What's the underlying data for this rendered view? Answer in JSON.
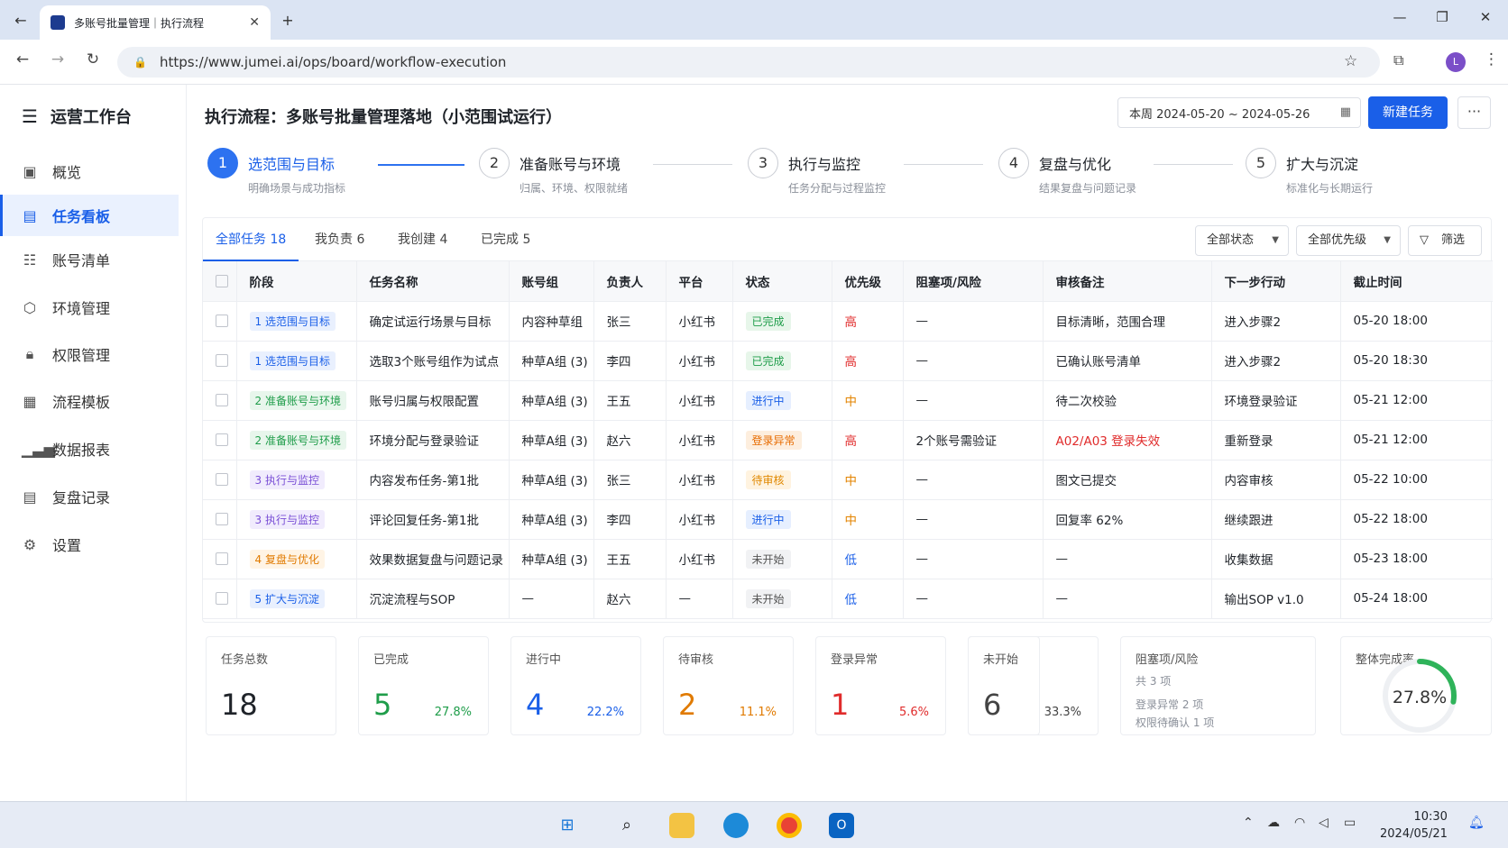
{
  "browser": {
    "tab_title": "多账号批量管理｜执行流程",
    "url": "https://www.jumei.ai/ops/board/workflow-execution",
    "profile_initial": "L"
  },
  "sidebar": {
    "brand": "运营工作台",
    "items": [
      {
        "label": "概览",
        "icon": "overview-icon"
      },
      {
        "label": "任务看板",
        "icon": "board-icon",
        "active": true
      },
      {
        "label": "账号清单",
        "icon": "list-icon"
      },
      {
        "label": "环境管理",
        "icon": "cube-icon"
      },
      {
        "label": "权限管理",
        "icon": "lock-icon"
      },
      {
        "label": "流程模板",
        "icon": "template-icon"
      },
      {
        "label": "数据报表",
        "icon": "chart-icon"
      },
      {
        "label": "复盘记录",
        "icon": "record-icon"
      },
      {
        "label": "设置",
        "icon": "gear-icon"
      }
    ]
  },
  "header": {
    "title": "执行流程：多账号批量管理落地（小范围试运行）",
    "date_range": "本周 2024-05-20 ~ 2024-05-26",
    "new_button": "新建任务",
    "more": "···"
  },
  "steps": [
    {
      "num": "1",
      "title": "选范围与目标",
      "sub": "明确场景与成功指标"
    },
    {
      "num": "2",
      "title": "准备账号与环境",
      "sub": "归属、环境、权限就绪"
    },
    {
      "num": "3",
      "title": "执行与监控",
      "sub": "任务分配与过程监控"
    },
    {
      "num": "4",
      "title": "复盘与优化",
      "sub": "结果复盘与问题记录"
    },
    {
      "num": "5",
      "title": "扩大与沉淀",
      "sub": "标准化与长期运行"
    }
  ],
  "filters": {
    "tabs": [
      {
        "label": "全部任务",
        "count": "18"
      },
      {
        "label": "我负责",
        "count": "6"
      },
      {
        "label": "我创建",
        "count": "4"
      },
      {
        "label": "已完成",
        "count": "5"
      }
    ],
    "status": "全部状态",
    "priority": "全部优先级",
    "filter": "筛选"
  },
  "table": {
    "headers": [
      "阶段",
      "任务名称",
      "账号组",
      "负责人",
      "平台",
      "状态",
      "优先级",
      "阻塞项/风险",
      "审核备注",
      "下一步行动",
      "截止时间"
    ],
    "rows": [
      {
        "stage": "1 选范围与目标",
        "name": "确定试运行场景与目标",
        "group": "内容种草组",
        "owner": "张三",
        "platform": "小红书",
        "status": "已完成",
        "priority": "高",
        "risk": "—",
        "note": "目标清晰，范围合理",
        "next": "进入步骤2",
        "due": "05-20 18:00"
      },
      {
        "stage": "1 选范围与目标",
        "name": "选取3个账号组作为试点",
        "group": "种草A组 (3)",
        "owner": "李四",
        "platform": "小红书",
        "status": "已完成",
        "priority": "高",
        "risk": "—",
        "note": "已确认账号清单",
        "next": "进入步骤2",
        "due": "05-20 18:30"
      },
      {
        "stage": "2 准备账号与环境",
        "name": "账号归属与权限配置",
        "group": "种草A组 (3)",
        "owner": "王五",
        "platform": "小红书",
        "status": "进行中",
        "priority": "中",
        "risk": "—",
        "note": "待二次校验",
        "next": "环境登录验证",
        "due": "05-21 12:00"
      },
      {
        "stage": "2 准备账号与环境",
        "name": "环境分配与登录验证",
        "group": "种草A组 (3)",
        "owner": "赵六",
        "platform": "小红书",
        "status": "登录异常",
        "priority": "高",
        "risk": "2个账号需验证",
        "note": "A02/A03 登录失效",
        "next": "重新登录",
        "due": "05-21 12:00"
      },
      {
        "stage": "3 执行与监控",
        "name": "内容发布任务-第1批",
        "group": "种草A组 (3)",
        "owner": "张三",
        "platform": "小红书",
        "status": "待审核",
        "priority": "中",
        "risk": "—",
        "note": "图文已提交",
        "next": "内容审核",
        "due": "05-22 10:00"
      },
      {
        "stage": "3 执行与监控",
        "name": "评论回复任务-第1批",
        "group": "种草A组 (3)",
        "owner": "李四",
        "platform": "小红书",
        "status": "进行中",
        "priority": "中",
        "risk": "—",
        "note": "回复率 62%",
        "next": "继续跟进",
        "due": "05-22 18:00"
      },
      {
        "stage": "4 复盘与优化",
        "name": "效果数据复盘与问题记录",
        "group": "种草A组 (3)",
        "owner": "王五",
        "platform": "小红书",
        "status": "未开始",
        "priority": "低",
        "risk": "—",
        "note": "—",
        "next": "收集数据",
        "due": "05-23 18:00"
      },
      {
        "stage": "5 扩大与沉淀",
        "name": "沉淀流程与SOP",
        "group": "—",
        "owner": "赵六",
        "platform": "—",
        "status": "未开始",
        "priority": "低",
        "risk": "—",
        "note": "—",
        "next": "输出SOP v1.0",
        "due": "05-24 18:00"
      }
    ]
  },
  "stats": {
    "total": {
      "label": "任务总数",
      "value": "18"
    },
    "done": {
      "label": "已完成",
      "value": "5",
      "pct": "27.8%",
      "color": "#1f9d4a"
    },
    "progress": {
      "label": "进行中",
      "value": "4",
      "pct": "22.2%",
      "color": "#1a5fe8"
    },
    "review": {
      "label": "待审核",
      "value": "2",
      "pct": "11.1%",
      "color": "#e07a00"
    },
    "error": {
      "label": "登录异常",
      "value": "1",
      "pct": "5.6%",
      "color": "#e02b2b"
    },
    "none": {
      "label": "未开始",
      "value": "6",
      "pct": "33.3%",
      "color": "#444444"
    },
    "risk": {
      "label": "阻塞项/风险",
      "total": "共 3 项",
      "line1": "登录异常 2 项",
      "line2": "权限待确认 1 项"
    },
    "rate": {
      "label": "整体完成率",
      "value": "27.8%",
      "fraction": 0.278,
      "color": "#2fb35a"
    }
  },
  "taskbar": {
    "time": "10:30",
    "date": "2024/05/21"
  }
}
